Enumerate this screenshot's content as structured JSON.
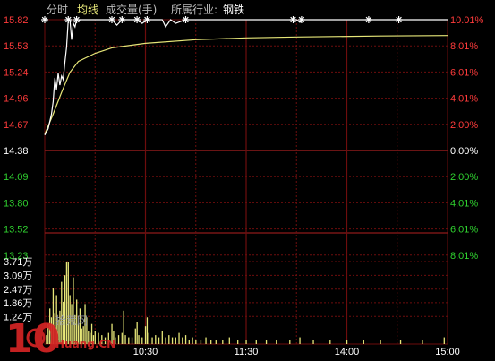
{
  "header": {
    "tab_fenshi": "分时",
    "tab_junxian": "均线",
    "volume_label": "成交量(手)",
    "industry_label": "所属行业:",
    "industry_value": "钢铁"
  },
  "colors": {
    "background": "#000000",
    "grid": "#6e0d0d",
    "up": "#ff3b3b",
    "down": "#2fd12f",
    "flat": "#ffffff",
    "price_line": "#ffffff",
    "avg_line": "#e6e678",
    "volume": "#e6e678",
    "header_active": "#e6e678",
    "header_muted": "#bdbdbd"
  },
  "watermark": {
    "brand_number": "10",
    "brand_cn": "拾荒网",
    "brand_url": "Huang.CN"
  },
  "chart_data": {
    "type": "line",
    "prev_close": 14.38,
    "price_axis": {
      "ticks": [
        "15.82",
        "15.53",
        "15.24",
        "14.96",
        "14.67",
        "14.38",
        "14.09",
        "13.80",
        "13.52",
        "13.23"
      ],
      "ylim": [
        13.09,
        15.82
      ]
    },
    "percent_axis": {
      "ticks": [
        "10.01%",
        "8.01%",
        "6.01%",
        "4.01%",
        "2.00%",
        "0.00%",
        "2.00%",
        "4.01%",
        "6.01%",
        "8.01%"
      ]
    },
    "time_axis": {
      "ticks": [
        "10:30",
        "11:30",
        "14:00",
        "15:00"
      ],
      "range_minutes": 240
    },
    "series": [
      {
        "key": "price",
        "points": [
          [
            0,
            14.55
          ],
          [
            2,
            14.62
          ],
          [
            4,
            14.78
          ],
          [
            5,
            14.92
          ],
          [
            6,
            15.18
          ],
          [
            7,
            15.05
          ],
          [
            8,
            15.23
          ],
          [
            9,
            15.1
          ],
          [
            10,
            15.2
          ],
          [
            11,
            15.16
          ],
          [
            12,
            15.35
          ],
          [
            13,
            15.52
          ],
          [
            14,
            15.82
          ],
          [
            15,
            15.82
          ],
          [
            16,
            15.6
          ],
          [
            17,
            15.78
          ],
          [
            18,
            15.74
          ],
          [
            19,
            15.82
          ],
          [
            20,
            15.8
          ],
          [
            21,
            15.82
          ],
          [
            40,
            15.82
          ],
          [
            43,
            15.76
          ],
          [
            46,
            15.82
          ],
          [
            55,
            15.82
          ],
          [
            58,
            15.78
          ],
          [
            61,
            15.82
          ],
          [
            70,
            15.82
          ],
          [
            72,
            15.74
          ],
          [
            75,
            15.82
          ],
          [
            78,
            15.78
          ],
          [
            81,
            15.8
          ],
          [
            84,
            15.82
          ],
          [
            150,
            15.82
          ],
          [
            152,
            15.79
          ],
          [
            154,
            15.82
          ],
          [
            240,
            15.82
          ]
        ]
      },
      {
        "key": "average",
        "points": [
          [
            0,
            14.56
          ],
          [
            5,
            14.78
          ],
          [
            10,
            15.02
          ],
          [
            15,
            15.24
          ],
          [
            20,
            15.36
          ],
          [
            30,
            15.45
          ],
          [
            40,
            15.51
          ],
          [
            60,
            15.56
          ],
          [
            90,
            15.6
          ],
          [
            120,
            15.62
          ],
          [
            150,
            15.63
          ],
          [
            200,
            15.64
          ],
          [
            240,
            15.645
          ]
        ]
      }
    ],
    "limit_up_marks": [
      0,
      14,
      19,
      40,
      46,
      55,
      61,
      84,
      148,
      153,
      193,
      211
    ],
    "volume": {
      "ticks": [
        "3.71万",
        "3.09万",
        "2.47万",
        "1.86万",
        "1.24万"
      ],
      "unit": "万手",
      "ylim": [
        0,
        4.6
      ],
      "bars": [
        [
          1,
          0.4
        ],
        [
          2,
          0.9
        ],
        [
          3,
          1.6
        ],
        [
          4,
          1.2
        ],
        [
          5,
          2.5
        ],
        [
          6,
          1.4
        ],
        [
          7,
          2.2
        ],
        [
          8,
          1.1
        ],
        [
          9,
          1.5
        ],
        [
          10,
          2.8
        ],
        [
          11,
          1.9
        ],
        [
          12,
          3.1
        ],
        [
          13,
          3.7
        ],
        [
          14,
          3.7
        ],
        [
          15,
          2.2
        ],
        [
          16,
          1.8
        ],
        [
          17,
          3.0
        ],
        [
          18,
          1.3
        ],
        [
          19,
          2.0
        ],
        [
          20,
          0.9
        ],
        [
          21,
          1.6
        ],
        [
          22,
          0.7
        ],
        [
          23,
          0.8
        ],
        [
          24,
          1.8
        ],
        [
          25,
          1.2
        ],
        [
          26,
          0.6
        ],
        [
          27,
          0.5
        ],
        [
          28,
          0.9
        ],
        [
          29,
          0.4
        ],
        [
          30,
          0.6
        ],
        [
          32,
          0.5
        ],
        [
          34,
          0.4
        ],
        [
          36,
          0.3
        ],
        [
          38,
          0.5
        ],
        [
          40,
          0.9
        ],
        [
          41,
          0.6
        ],
        [
          42,
          0.3
        ],
        [
          44,
          0.4
        ],
        [
          46,
          0.5
        ],
        [
          47,
          1.5
        ],
        [
          48,
          0.4
        ],
        [
          50,
          0.3
        ],
        [
          52,
          0.3
        ],
        [
          54,
          0.7
        ],
        [
          55,
          1.0
        ],
        [
          56,
          0.4
        ],
        [
          58,
          0.3
        ],
        [
          60,
          0.8
        ],
        [
          61,
          1.2
        ],
        [
          62,
          0.5
        ],
        [
          64,
          0.3
        ],
        [
          66,
          0.4
        ],
        [
          68,
          0.3
        ],
        [
          70,
          0.6
        ],
        [
          72,
          0.3
        ],
        [
          74,
          0.4
        ],
        [
          76,
          0.3
        ],
        [
          78,
          0.3
        ],
        [
          80,
          0.5
        ],
        [
          82,
          0.3
        ],
        [
          84,
          0.4
        ],
        [
          86,
          0.2
        ],
        [
          88,
          0.3
        ],
        [
          90,
          0.2
        ],
        [
          93,
          0.2
        ],
        [
          96,
          0.3
        ],
        [
          99,
          0.2
        ],
        [
          102,
          0.2
        ],
        [
          106,
          0.2
        ],
        [
          110,
          0.3
        ],
        [
          115,
          0.2
        ],
        [
          120,
          0.2
        ],
        [
          126,
          0.2
        ],
        [
          132,
          0.2
        ],
        [
          138,
          0.2
        ],
        [
          146,
          0.2
        ],
        [
          152,
          0.3
        ],
        [
          160,
          0.2
        ],
        [
          170,
          0.2
        ],
        [
          180,
          0.2
        ],
        [
          190,
          0.2
        ],
        [
          200,
          0.2
        ],
        [
          212,
          0.2
        ],
        [
          225,
          0.2
        ],
        [
          238,
          0.3
        ]
      ]
    }
  }
}
